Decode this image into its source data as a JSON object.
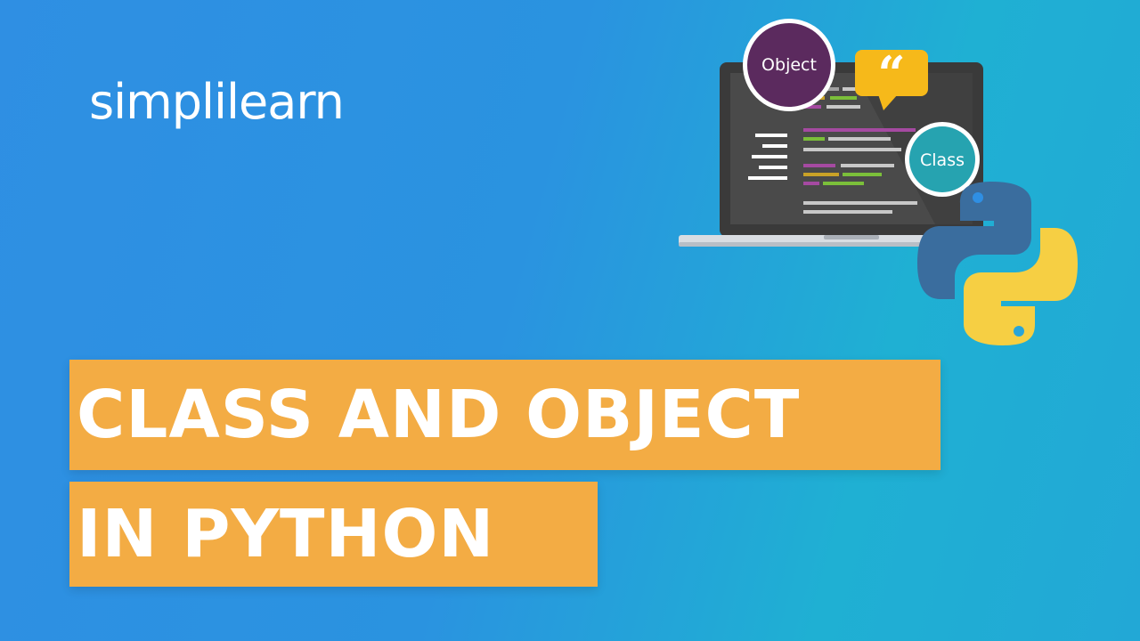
{
  "brand": {
    "logo_text": "simplilearn"
  },
  "title": {
    "line1": "CLASS AND OBJECT",
    "line2": "IN PYTHON"
  },
  "illustration": {
    "bubble_object_label": "Object",
    "bubble_class_label": "Class",
    "quote_glyph": "“"
  },
  "colors": {
    "background_start": "#2f8fe3",
    "background_end": "#1fb0d3",
    "band": "#f3ac44",
    "object_bubble": "#5b2a5e",
    "class_bubble": "#26a3b0",
    "quote_bubble": "#f6b91a",
    "python_blue": "#3a6d9e",
    "python_yellow": "#f6cf43"
  },
  "icons": [
    "laptop-icon",
    "python-logo-icon",
    "quote-bubble-icon"
  ]
}
